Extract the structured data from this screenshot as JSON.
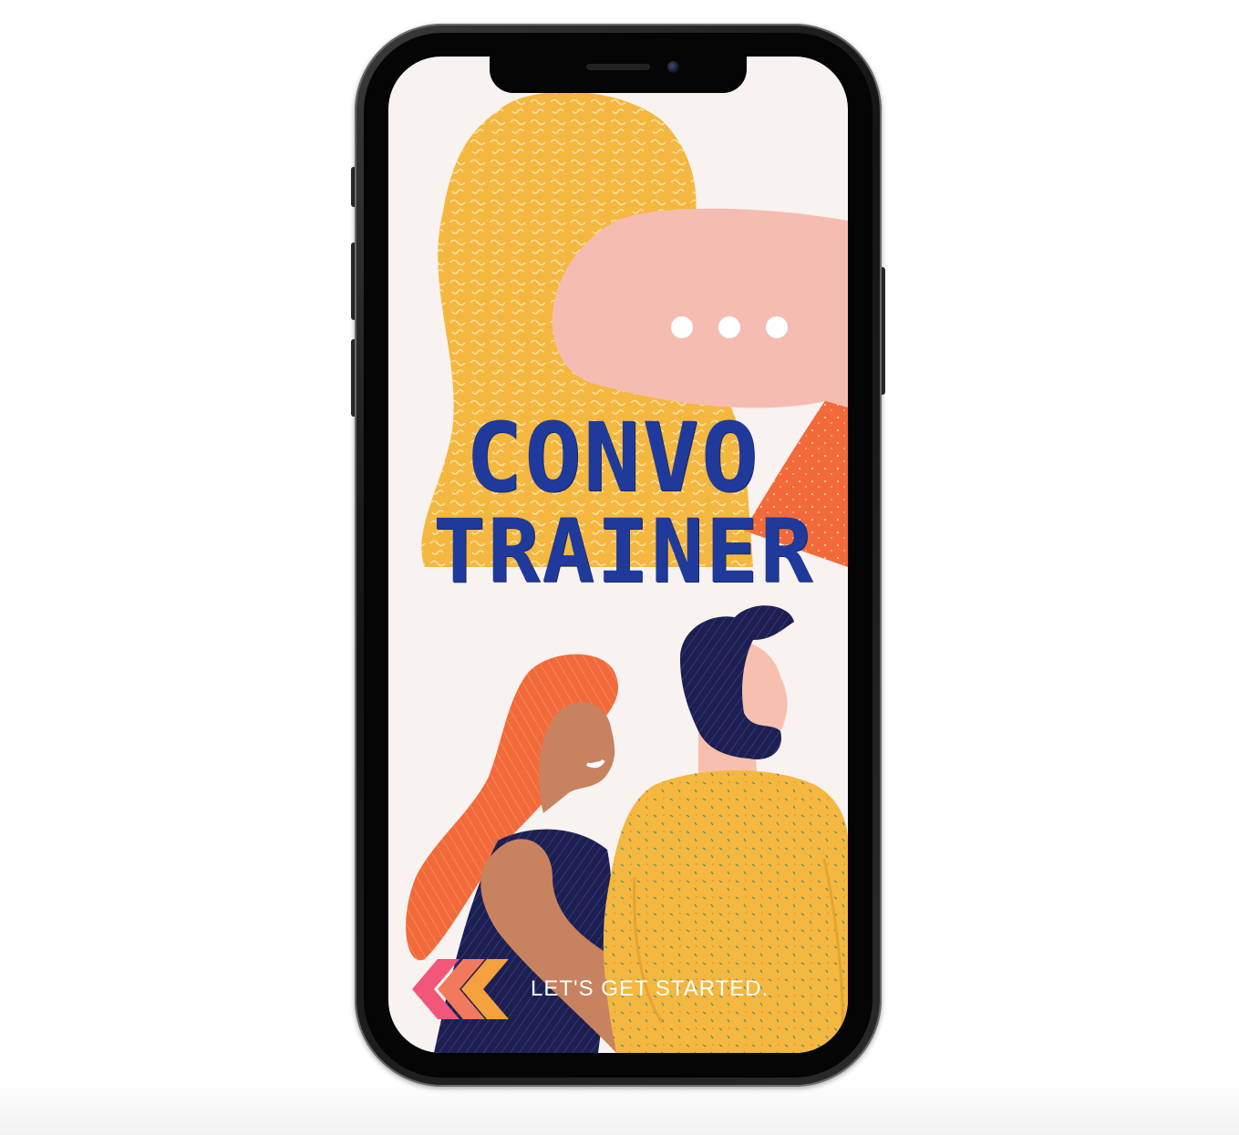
{
  "app": {
    "title_line1": "CONVO",
    "title_line2": "TRAINER",
    "cta_label": "LET'S GET STARTED."
  },
  "colors": {
    "screen_background": "#f8f2f0",
    "title_blue": "#1f3a9a",
    "hair_yellow": "#f4b740",
    "speech_bubble_pink": "#f5bcb2",
    "accent_orange": "#f26a3a",
    "navy": "#1c1f4f",
    "skin": "#c7825f",
    "chevron_pink": "#f2577a",
    "chevron_orange": "#f5a13e"
  },
  "icons": {
    "speech_bubble": "speech-bubble-icon",
    "typing_dots": "ellipsis-icon",
    "chevrons": "double-chevron-left-icon"
  }
}
